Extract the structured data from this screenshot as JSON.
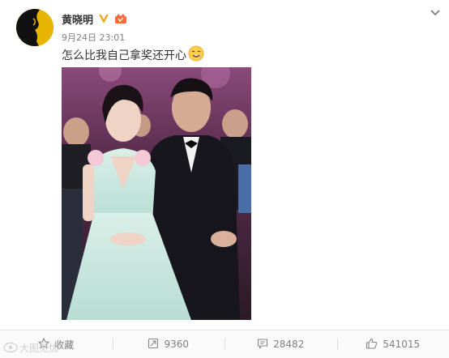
{
  "post": {
    "author": "黄晓明",
    "timestamp": "9月24日 23:01",
    "text": "怎么比我自己拿奖还开心",
    "emoji_icon": "grin-emoji-icon",
    "verified_icon": "verified-v-icon",
    "member_icon": "member-crown-icon"
  },
  "actions": {
    "favorite": {
      "icon": "star-icon",
      "label": "收藏"
    },
    "repost": {
      "icon": "repost-icon",
      "count": "9360"
    },
    "comment": {
      "icon": "comment-icon",
      "count": "28482"
    },
    "like": {
      "icon": "thumbs-up-icon",
      "count": "541015"
    }
  },
  "watermark": {
    "text": "大图无忧"
  },
  "colors": {
    "brand_orange": "#f5a623",
    "text_main": "#333333",
    "text_meta": "#808080",
    "bar_bg": "#fafafa"
  }
}
